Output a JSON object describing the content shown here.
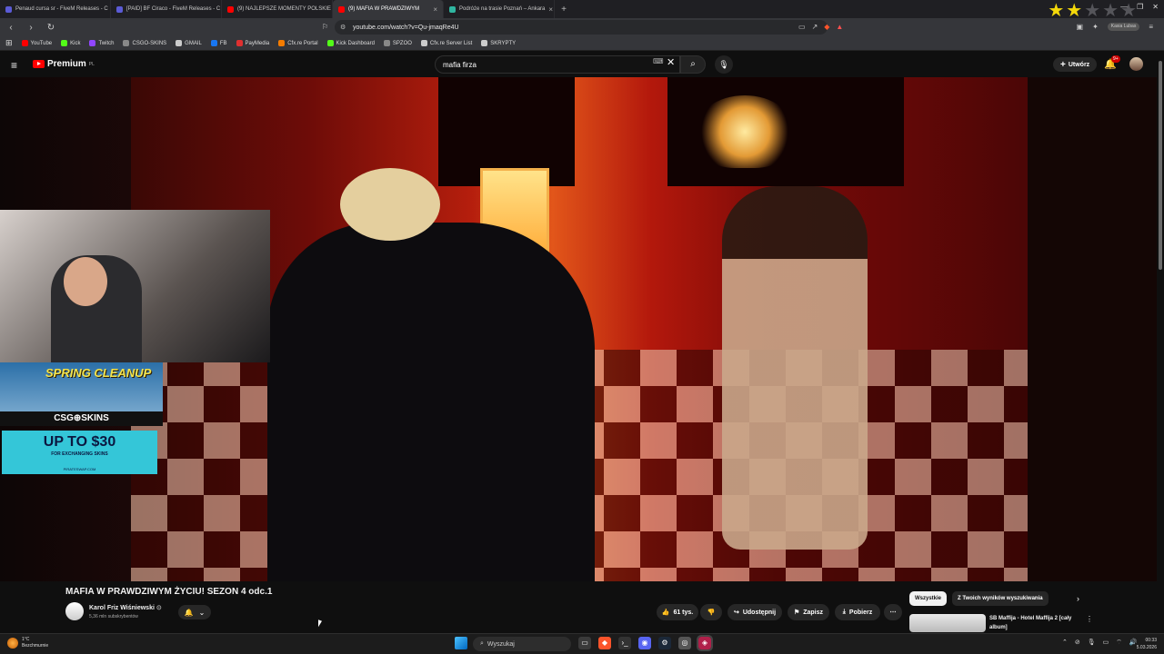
{
  "browser": {
    "tabs": [
      {
        "label": "Penaud cursa sr - FiveM Releases - C",
        "color": "#5b5bd6"
      },
      {
        "label": "[PAID] BF Ciraco - FiveM Releases - C",
        "color": "#5b5bd6"
      },
      {
        "label": "(9) NAJLEPSZE MOMENTY POLSKIE",
        "color": "#ff0000"
      },
      {
        "label": "(9) MAFIA W PRAWDZIWYM",
        "color": "#ff0000",
        "active": true
      },
      {
        "label": "Podróże na trasie Poznań – Ankara",
        "color": "#2fb5a0"
      }
    ],
    "new_tab": "+",
    "window_controls": [
      "—",
      "❐",
      "✕"
    ],
    "url": "youtube.com/watch?v=Qu-jmaqRe4U",
    "bookmarks": [
      {
        "label": "YouTube",
        "color": "#ff0000"
      },
      {
        "label": "Kick",
        "color": "#53fc18"
      },
      {
        "label": "Twitch",
        "color": "#9146ff"
      },
      {
        "label": "CSGO-SKINS",
        "color": "#888888"
      },
      {
        "label": "GMAIL",
        "color": "#cccccc"
      },
      {
        "label": "FB",
        "color": "#1877f2"
      },
      {
        "label": "PayMedia",
        "color": "#e03030"
      },
      {
        "label": "Cfx.re Portal",
        "color": "#f57c00"
      },
      {
        "label": "Kick Dashboard",
        "color": "#53fc18"
      },
      {
        "label": "SPZOO",
        "color": "#888888"
      },
      {
        "label": "Cfx.re Server List",
        "color": "#cccccc"
      },
      {
        "label": "SKRYPTY",
        "color": "#cccccc"
      }
    ],
    "star_rating": 2,
    "star_total": 5,
    "profile_chip": "Kasia Lubas"
  },
  "youtube": {
    "logo": "Premium",
    "logo_region": "PL",
    "search_value": "mafia firza",
    "create_label": "Utwórz",
    "notif_badge": "9+",
    "video": {
      "title": "MAFIA W PRAWDZIWYM ŻYCIU! SEZON 4 odc.1",
      "channel": "Karol Friz Wiśniewski",
      "subscribers": "5,36 mln subskrybentów",
      "likes": "61 tys.",
      "share": "Udostępnij",
      "save": "Zapisz",
      "download": "Pobierz"
    },
    "chips": [
      "Wszystkie",
      "Z Twoich wyników wyszukiwania"
    ],
    "recommendation": {
      "title": "SB Maffija - Hotel Maffija 2 [cały album]"
    }
  },
  "overlay_ads": {
    "ad1_title": "SPRING CLEANUP",
    "ad1_brand": "CSG⊕SKINS",
    "ad2_big": "UP TO $30",
    "ad2_small": "FOR EXCHANGING SKINS",
    "ad2_site": "PIRATESWAP.COM"
  },
  "taskbar": {
    "weather_temp": "1°C",
    "weather_desc": "Bezchmurnie",
    "search_label": "Wyszukaj",
    "time": "00:33",
    "date": "5.03.2026"
  }
}
